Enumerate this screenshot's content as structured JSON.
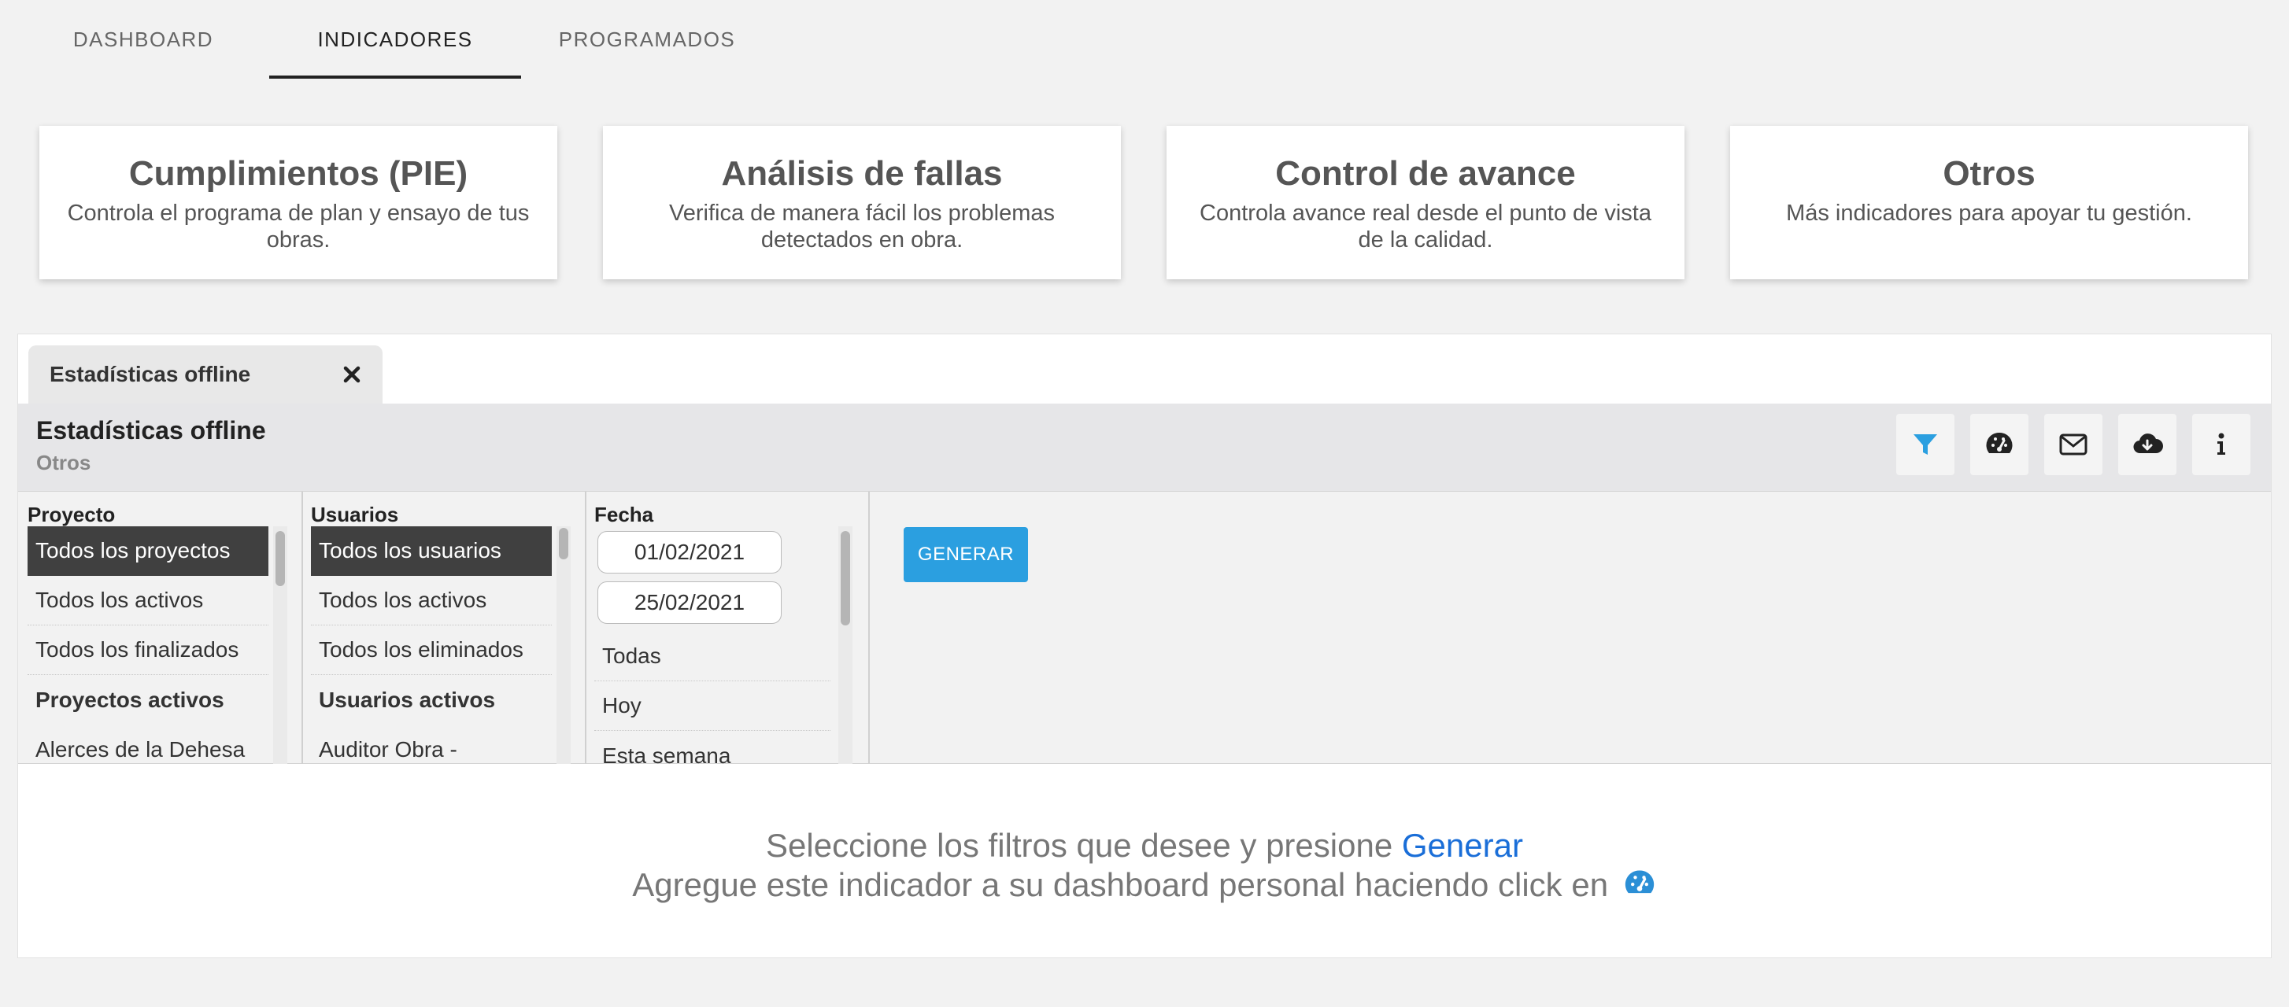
{
  "top_tabs": [
    {
      "label": "DASHBOARD",
      "active": false
    },
    {
      "label": "INDICADORES",
      "active": true
    },
    {
      "label": "PROGRAMADOS",
      "active": false
    }
  ],
  "cards": [
    {
      "title": "Cumplimientos (PIE)",
      "description": "Controla el programa de plan y ensayo de tus obras."
    },
    {
      "title": "Análisis de fallas",
      "description": "Verifica de manera fácil los problemas detectados en obra."
    },
    {
      "title": "Control de avance",
      "description": "Controla avance real desde el punto de vista de la calidad."
    },
    {
      "title": "Otros",
      "description": "Más indicadores para apoyar tu gestión."
    }
  ],
  "panel": {
    "tab_label": "Estadísticas offline",
    "title": "Estadísticas offline",
    "subtitle": "Otros",
    "toolbar_icons": [
      "filter-icon",
      "gauge-icon",
      "envelope-icon",
      "cloud-download-icon",
      "info-icon"
    ],
    "colors": {
      "accent": "#2b9fe0",
      "link": "#1a6ed8",
      "selected_bg": "#404040"
    }
  },
  "filters": {
    "proyecto": {
      "label": "Proyecto",
      "options": [
        "Todos los proyectos",
        "Todos los activos",
        "Todos los finalizados"
      ],
      "group_label": "Proyectos activos",
      "items": [
        "Alerces de la Dehesa"
      ]
    },
    "usuarios": {
      "label": "Usuarios",
      "options": [
        "Todos los usuarios",
        "Todos los activos",
        "Todos los eliminados"
      ],
      "group_label": "Usuarios activos",
      "items": [
        "Auditor Obra -"
      ]
    },
    "fecha": {
      "label": "Fecha",
      "start": "01/02/2021",
      "end": "25/02/2021",
      "options": [
        "Todas",
        "Hoy",
        "Esta semana"
      ]
    }
  },
  "generate_label": "GENERAR",
  "message": {
    "line1_prefix": "Seleccione los filtros que desee y presione ",
    "line1_link": "Generar",
    "line2": "Agregue este indicador a su dashboard personal haciendo click en "
  }
}
